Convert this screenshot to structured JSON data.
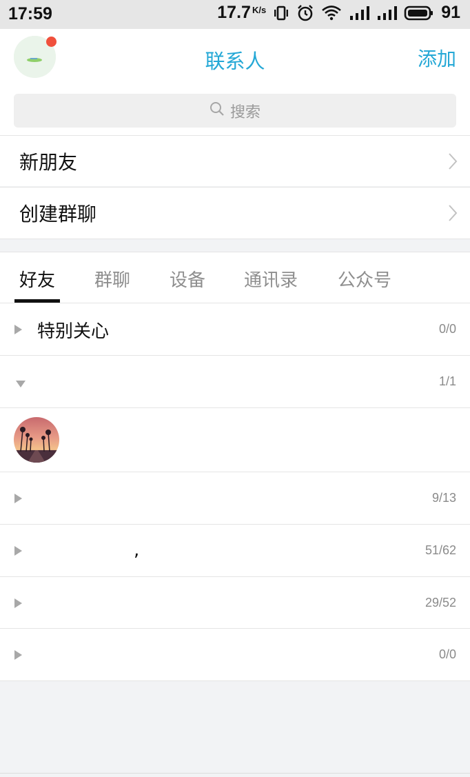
{
  "status_bar": {
    "time": "17:59",
    "speed_value": "17.7",
    "speed_unit": "K/s",
    "battery": "91",
    "icons": [
      "vibrate-icon",
      "alarm-icon",
      "wifi-icon",
      "signal-icon",
      "signal-icon",
      "battery-icon"
    ]
  },
  "header": {
    "title": "联系人",
    "add_label": "添加",
    "search_placeholder": "搜索",
    "accent_color": "#25a8d6",
    "badge_color": "#f0503c"
  },
  "entries": [
    {
      "label": "新朋友"
    },
    {
      "label": "创建群聊"
    }
  ],
  "tabs": [
    {
      "label": "好友",
      "active": true
    },
    {
      "label": "群聊",
      "active": false
    },
    {
      "label": "设备",
      "active": false
    },
    {
      "label": "通讯录",
      "active": false
    },
    {
      "label": "公众号",
      "active": false
    }
  ],
  "groups": [
    {
      "name": "特别关心",
      "count": "0/0",
      "expanded": false
    },
    {
      "name": "",
      "count": "1/1",
      "expanded": true
    },
    {
      "name": "",
      "count": "9/13",
      "expanded": false
    },
    {
      "name": ",",
      "count": "51/62",
      "expanded": false
    },
    {
      "name": "",
      "count": "29/52",
      "expanded": false
    },
    {
      "name": "",
      "count": "0/0",
      "expanded": false
    }
  ]
}
